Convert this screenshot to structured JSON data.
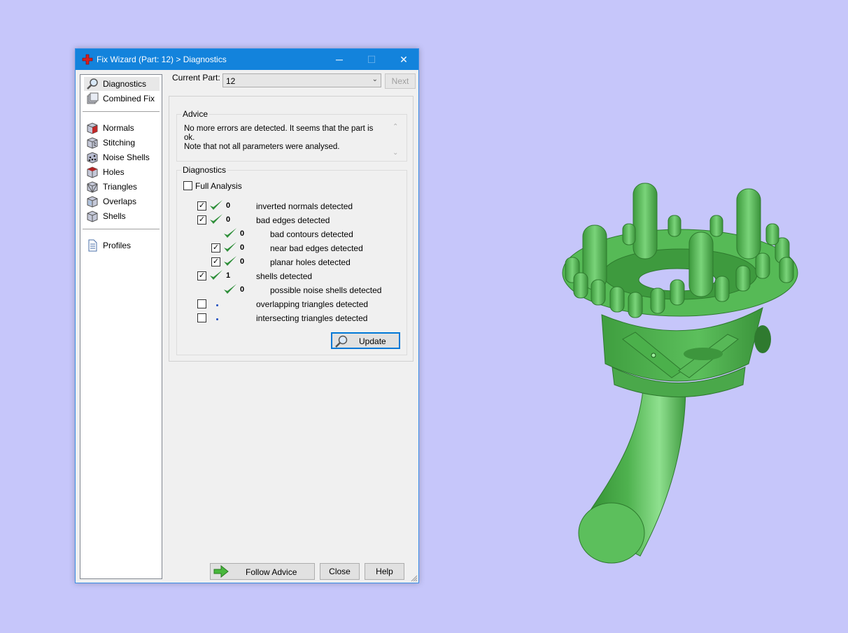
{
  "window": {
    "title": "Fix Wizard (Part: 12) > Diagnostics",
    "minimize_glyph": "─",
    "maximize_glyph": "☐",
    "close_glyph": "✕"
  },
  "sidebar": {
    "items": [
      {
        "label": "Diagnostics",
        "icon": "magnifier-icon",
        "selected": true
      },
      {
        "label": "Combined Fix",
        "icon": "layers-icon"
      },
      {
        "label": "Normals",
        "icon": "normals-cube-icon"
      },
      {
        "label": "Stitching",
        "icon": "stitching-cube-icon"
      },
      {
        "label": "Noise Shells",
        "icon": "noise-shells-icon"
      },
      {
        "label": "Holes",
        "icon": "holes-cube-icon"
      },
      {
        "label": "Triangles",
        "icon": "triangles-cube-icon"
      },
      {
        "label": "Overlaps",
        "icon": "overlaps-cube-icon"
      },
      {
        "label": "Shells",
        "icon": "shells-cube-icon"
      },
      {
        "label": "Profiles",
        "icon": "document-icon"
      }
    ]
  },
  "header": {
    "current_part_label": "Current Part:",
    "current_part_value": "12",
    "next_label": "Next"
  },
  "advice": {
    "title": "Advice",
    "text_line1": "No more errors are detected. It seems that the part is ok.",
    "text_line2": "Note that not all parameters were analysed."
  },
  "diagnostics": {
    "title": "Diagnostics",
    "full_analysis_label": "Full Analysis",
    "full_analysis_checked": false,
    "rows": [
      {
        "checked": true,
        "status": "ok",
        "count": "0",
        "label": "inverted normals detected"
      },
      {
        "checked": true,
        "status": "ok",
        "count": "0",
        "label": "bad edges detected"
      },
      {
        "checked": null,
        "status": "ok",
        "count": "0",
        "label": "bad contours detected"
      },
      {
        "checked": true,
        "status": "ok",
        "count": "0",
        "label": "near bad edges detected"
      },
      {
        "checked": true,
        "status": "ok",
        "count": "0",
        "label": "planar holes detected"
      },
      {
        "checked": true,
        "status": "ok",
        "count": "1",
        "label": "shells detected"
      },
      {
        "checked": null,
        "status": "ok",
        "count": "0",
        "label": "possible noise shells detected"
      },
      {
        "checked": false,
        "status": "pending",
        "count": "",
        "label": "overlapping triangles detected"
      },
      {
        "checked": false,
        "status": "pending",
        "count": "",
        "label": "intersecting triangles detected"
      }
    ],
    "update_label": "Update"
  },
  "footer": {
    "follow_advice_label": "Follow Advice",
    "close_label": "Close",
    "help_label": "Help"
  },
  "colors": {
    "desktop": "#c6c6fa",
    "titlebar": "#1383dc",
    "model_green": "#5cbf5c",
    "check_green": "#2f8f3a"
  }
}
